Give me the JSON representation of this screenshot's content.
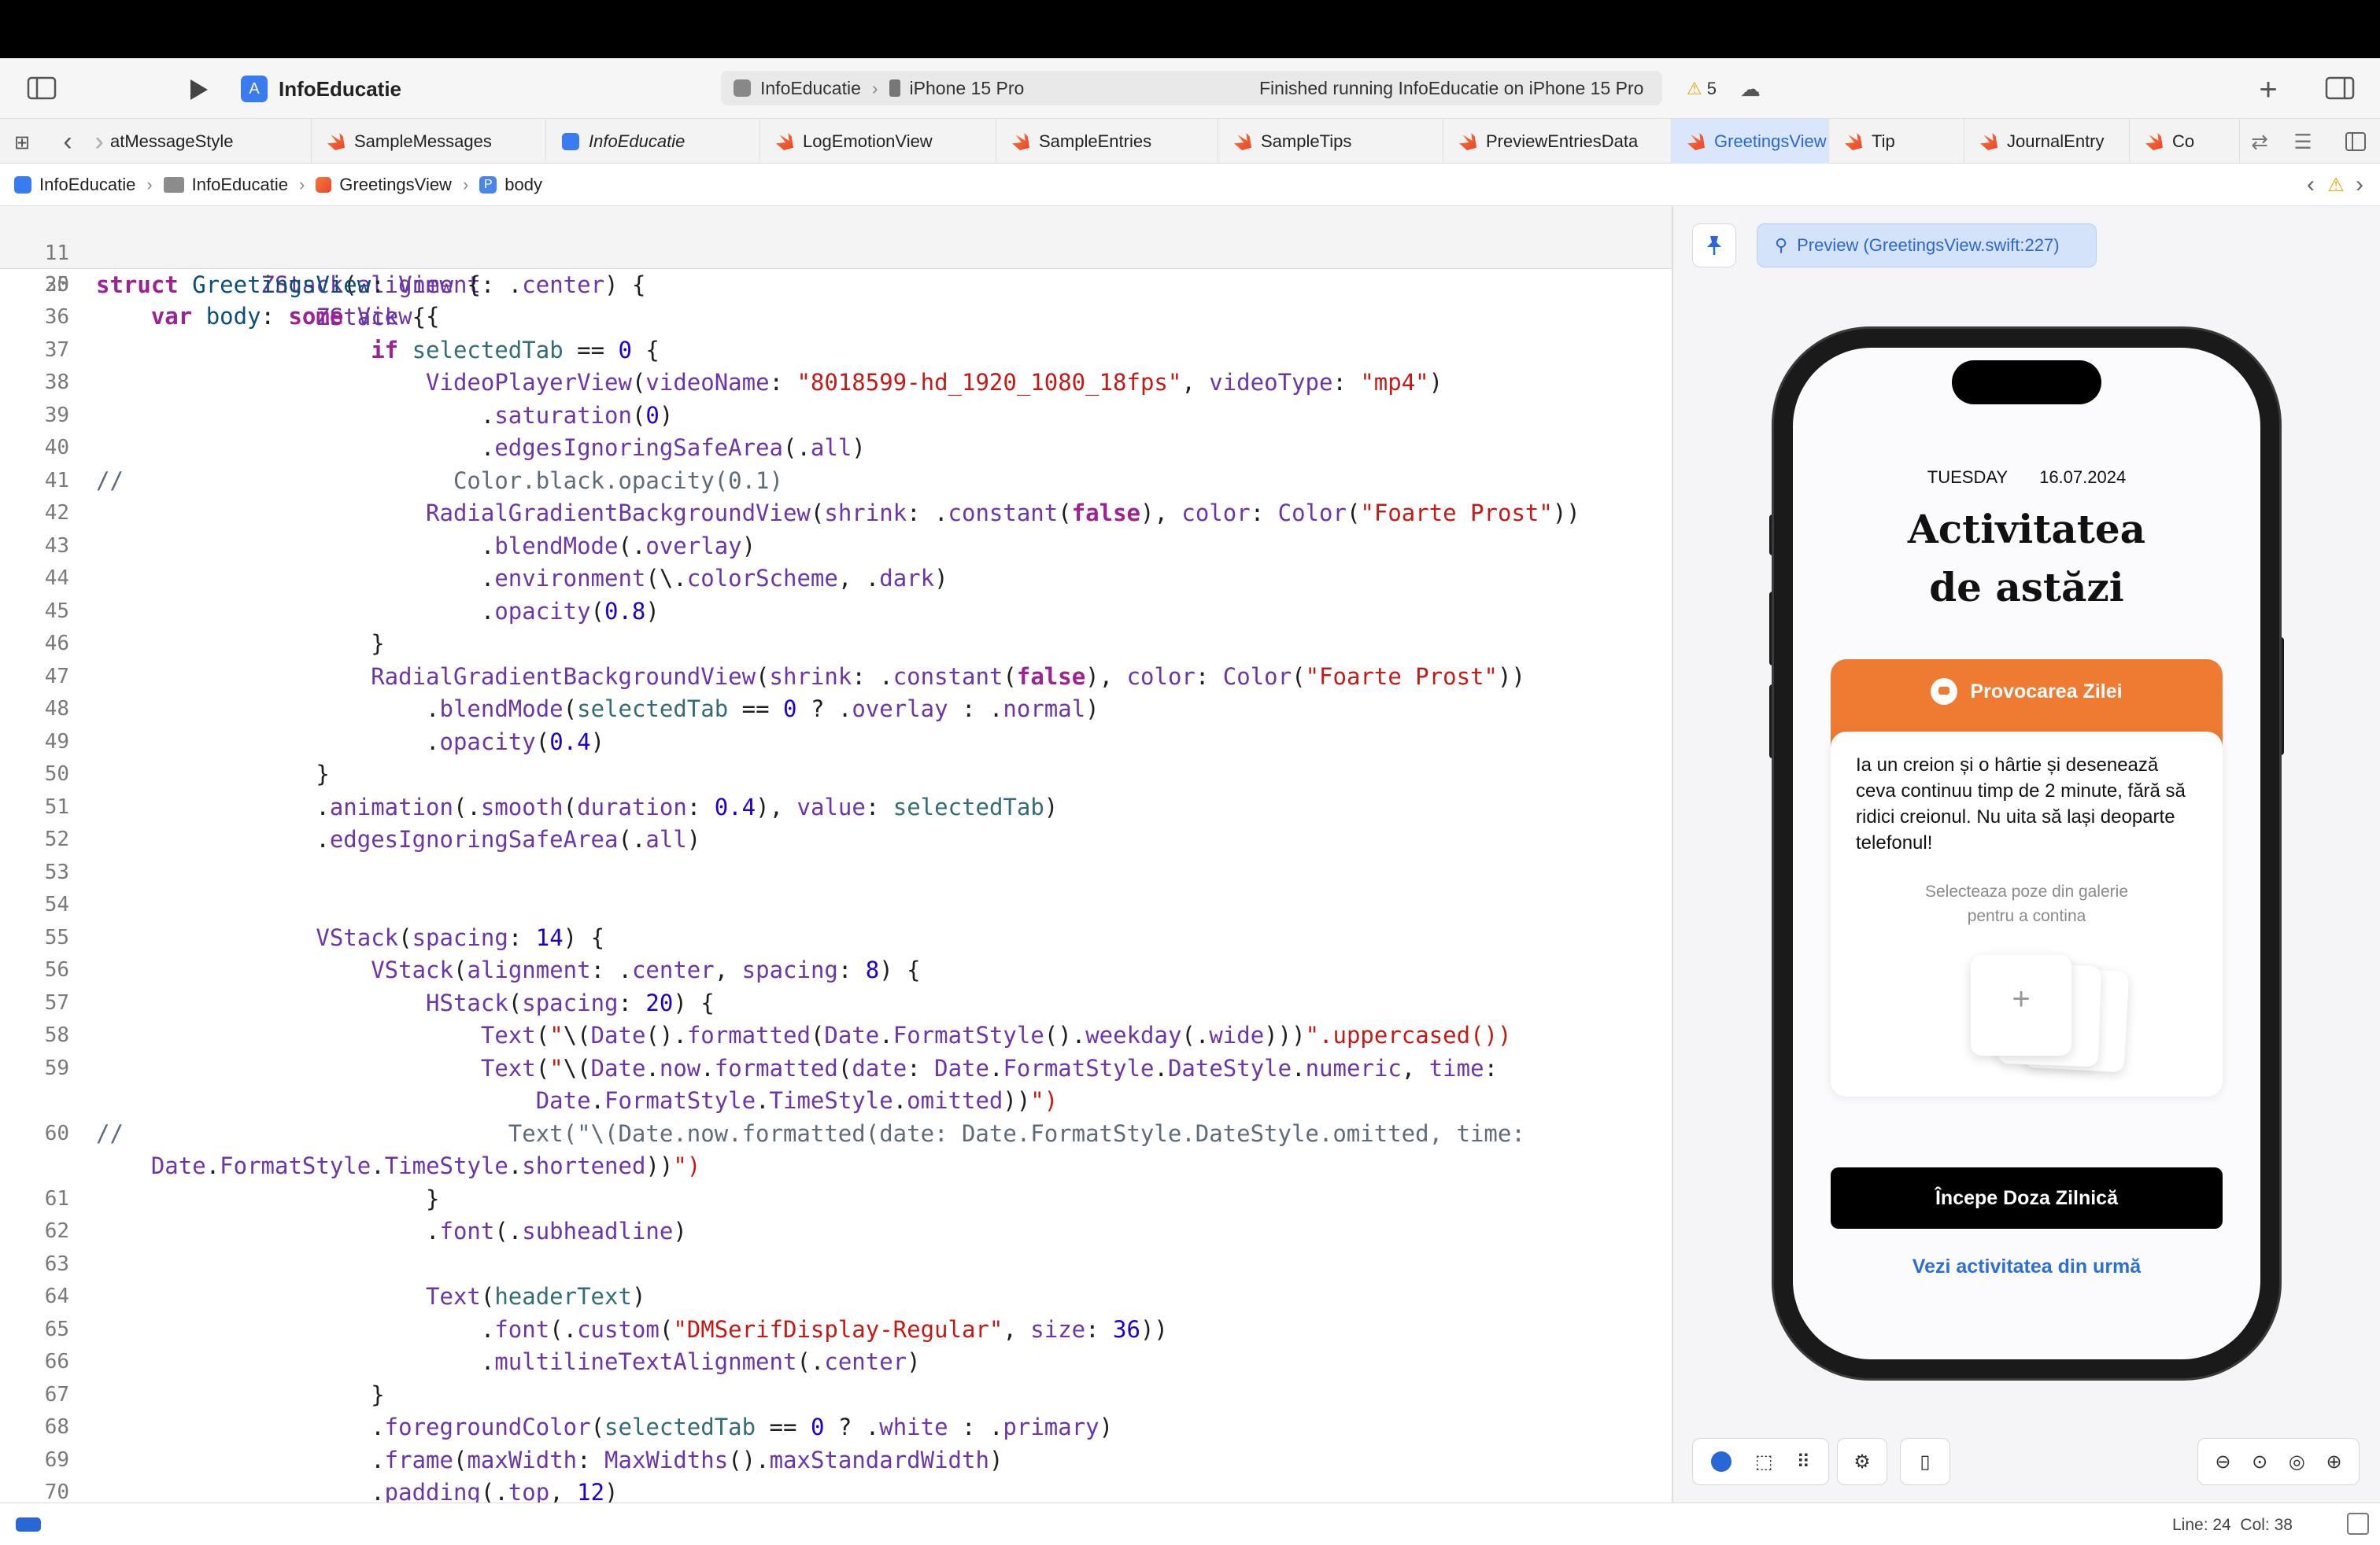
{
  "toolbar": {
    "project": "InfoEducatie",
    "scheme": "InfoEducatie",
    "device": "iPhone 15 Pro",
    "status": "Finished running InfoEducatie on iPhone 15 Pro",
    "warnings": "5"
  },
  "tabs": [
    {
      "label": "atMessageStyle",
      "kind": "swift"
    },
    {
      "label": "SampleMessages",
      "kind": "swift"
    },
    {
      "label": "InfoEducatie",
      "kind": "app"
    },
    {
      "label": "LogEmotionView",
      "kind": "swift"
    },
    {
      "label": "SampleEntries",
      "kind": "swift"
    },
    {
      "label": "SampleTips",
      "kind": "swift"
    },
    {
      "label": "PreviewEntriesData",
      "kind": "swift"
    },
    {
      "label": "GreetingsView",
      "kind": "swift"
    },
    {
      "label": "Tip",
      "kind": "swift"
    },
    {
      "label": "JournalEntry",
      "kind": "swift"
    },
    {
      "label": "Co",
      "kind": "swift"
    }
  ],
  "breadcrumb": [
    "InfoEducatie",
    "InfoEducatie",
    "GreetingsView",
    "body"
  ],
  "sticky": [
    {
      "num": "11",
      "code": "struct GreetingsView: View {"
    },
    {
      "num": "20",
      "code": "    var body: some View {"
    }
  ],
  "code_lines": [
    {
      "num": "34",
      "code": ""
    },
    {
      "num": "35",
      "code": "            ZStack(alignment: .center) {"
    },
    {
      "num": "36",
      "code": "                ZStack {"
    },
    {
      "num": "37",
      "code": "                    if selectedTab == 0 {"
    },
    {
      "num": "38",
      "code": "                        VideoPlayerView(videoName: \"8018599-hd_1920_1080_18fps\", videoType: \"mp4\")"
    },
    {
      "num": "39",
      "code": "                            .saturation(0)"
    },
    {
      "num": "40",
      "code": "                            .edgesIgnoringSafeArea(.all)"
    },
    {
      "num": "41",
      "code": "//                        Color.black.opacity(0.1)"
    },
    {
      "num": "42",
      "code": "                        RadialGradientBackgroundView(shrink: .constant(false), color: Color(\"Foarte Prost\"))"
    },
    {
      "num": "43",
      "code": "                            .blendMode(.overlay)"
    },
    {
      "num": "44",
      "code": "                            .environment(\\.colorScheme, .dark)"
    },
    {
      "num": "45",
      "code": "                            .opacity(0.8)"
    },
    {
      "num": "46",
      "code": "                    }"
    },
    {
      "num": "47",
      "code": "                    RadialGradientBackgroundView(shrink: .constant(false), color: Color(\"Foarte Prost\"))"
    },
    {
      "num": "48",
      "code": "                        .blendMode(selectedTab == 0 ? .overlay : .normal)"
    },
    {
      "num": "49",
      "code": "                        .opacity(0.4)"
    },
    {
      "num": "50",
      "code": "                }"
    },
    {
      "num": "51",
      "code": "                .animation(.smooth(duration: 0.4), value: selectedTab)"
    },
    {
      "num": "52",
      "code": "                .edgesIgnoringSafeArea(.all)"
    },
    {
      "num": "53",
      "code": ""
    },
    {
      "num": "54",
      "code": ""
    },
    {
      "num": "55",
      "code": "                VStack(spacing: 14) {"
    },
    {
      "num": "56",
      "code": "                    VStack(alignment: .center, spacing: 8) {"
    },
    {
      "num": "57",
      "code": "                        HStack(spacing: 20) {"
    },
    {
      "num": "58",
      "code": "                            Text(\"\\(Date().formatted(Date.FormatStyle().weekday(.wide)))\".uppercased())"
    },
    {
      "num": "59",
      "code": "                            Text(\"\\(Date.now.formatted(date: Date.FormatStyle.DateStyle.numeric, time:"
    },
    {
      "num": "",
      "code": "                                Date.FormatStyle.TimeStyle.omitted))\")"
    },
    {
      "num": "60",
      "code": "//                            Text(\"\\(Date.now.formatted(date: Date.FormatStyle.DateStyle.omitted, time:"
    },
    {
      "num": "",
      "code": "    Date.FormatStyle.TimeStyle.shortened))\")"
    },
    {
      "num": "61",
      "code": "                        }"
    },
    {
      "num": "62",
      "code": "                        .font(.subheadline)"
    },
    {
      "num": "63",
      "code": ""
    },
    {
      "num": "64",
      "code": "                        Text(headerText)"
    },
    {
      "num": "65",
      "code": "                            .font(.custom(\"DMSerifDisplay-Regular\", size: 36))"
    },
    {
      "num": "66",
      "code": "                            .multilineTextAlignment(.center)"
    },
    {
      "num": "67",
      "code": "                    }"
    },
    {
      "num": "68",
      "code": "                    .foregroundColor(selectedTab == 0 ? .white : .primary)"
    },
    {
      "num": "69",
      "code": "                    .frame(maxWidth: MaxWidths().maxStandardWidth)"
    },
    {
      "num": "70",
      "code": "                    .padding(.top, 12)"
    },
    {
      "num": "71",
      "code": ""
    }
  ],
  "preview": {
    "pill": "Preview (GreetingsView.swift:227)",
    "weekday": "TUESDAY",
    "date": "16.07.2024",
    "headline_1": "Activitatea",
    "headline_2": "de astăzi",
    "challenge_title": "Provocarea Zilei",
    "challenge_text": "Ia un creion și o hârtie și desenează ceva continuu timp de 2 minute, fără să ridici creionul. Nu uita să lași deoparte telefonul!",
    "gallery_hint_1": "Selecteaza poze din galerie",
    "gallery_hint_2": "pentru a contina",
    "plus": "+",
    "start_button": "Începe Doza Zilnică",
    "past_link": "Vezi activitatea din urmă"
  },
  "status": {
    "line_col": "Line: 24  Col: 38"
  },
  "colors": {
    "accent": "#2a67d6",
    "orange": "#ef7a32",
    "keyword": "#9b2393",
    "string": "#c41a16",
    "number": "#1c00cf"
  }
}
